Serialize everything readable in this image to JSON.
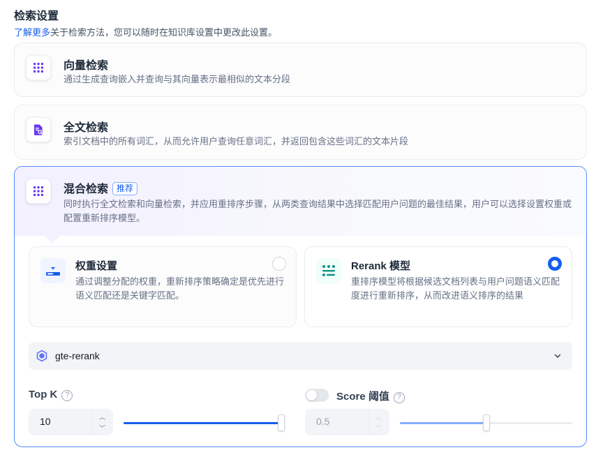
{
  "header": {
    "title": "检索设置",
    "learn_more": "了解更多",
    "description": "关于检索方法，您可以随时在知识库设置中更改此设置。"
  },
  "methods": {
    "vector": {
      "title": "向量检索",
      "description": "通过生成查询嵌入并查询与其向量表示最相似的文本分段",
      "icon": "grid-dots-icon"
    },
    "fulltext": {
      "title": "全文检索",
      "description": "索引文档中的所有词汇，从而允许用户查询任意词汇，并返回包含这些词汇的文本片段",
      "icon": "document-search-icon"
    },
    "hybrid": {
      "title": "混合检索",
      "badge": "推荐",
      "description": "同时执行全文检索和向量检索，并应用重排序步骤，从两类查询结果中选择匹配用户问题的最佳结果，用户可以选择设置权重或配置重新排序模型。",
      "icon": "grid-dots-icon",
      "selected": true
    }
  },
  "hybrid_options": {
    "weight": {
      "title": "权重设置",
      "description": "通过调整分配的权重，重新排序策略确定是优先进行语义匹配还是关键字匹配。",
      "selected": false
    },
    "rerank": {
      "title": "Rerank 模型",
      "description": "重排序模型将根据候选文档列表与用户问题语义匹配度进行重新排序，从而改进语义排序的结果",
      "selected": true
    }
  },
  "model_select": {
    "value": "gte-rerank"
  },
  "top_k": {
    "label": "Top K",
    "help": "?",
    "value": "10",
    "min": 1,
    "max": 10,
    "up": "︿",
    "down": "﹀"
  },
  "score_threshold": {
    "label": "Score 阈值",
    "help": "?",
    "enabled": false,
    "value": "0.5",
    "fraction": 0.5,
    "up": "︿",
    "down": "﹀"
  },
  "colors": {
    "accent": "#155eef",
    "purple": "#6938ef",
    "teal": "#0e9384"
  }
}
